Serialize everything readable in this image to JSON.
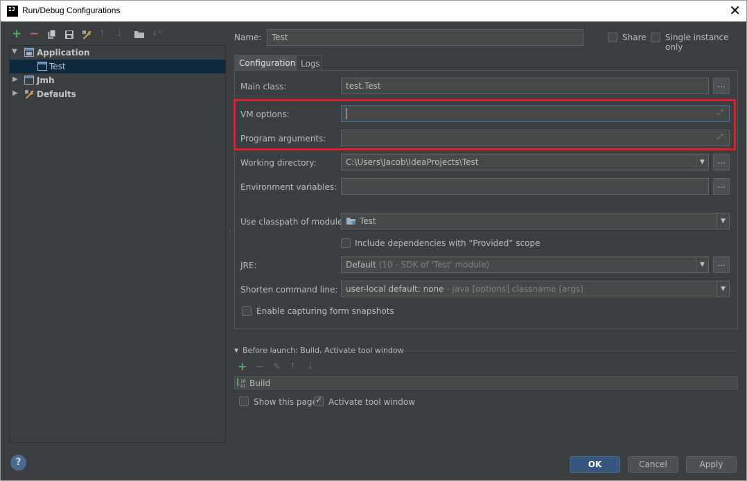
{
  "window": {
    "title": "Run/Debug Configurations",
    "app_icon": "IJ"
  },
  "toolbar": {
    "icons": [
      "add-icon",
      "remove-icon",
      "copy-icon",
      "save-icon",
      "wrench-icon",
      "arrow-up-icon",
      "arrow-down-icon",
      "folder-icon",
      "sort-icon"
    ]
  },
  "tree": {
    "items": [
      {
        "label": "Application"
      },
      {
        "label": "Test"
      },
      {
        "label": "Jmh"
      },
      {
        "label": "Defaults"
      }
    ]
  },
  "header": {
    "name_label": "Name:",
    "name_value": "Test",
    "share_label": "Share",
    "single_instance_label": "Single instance only"
  },
  "tabs": [
    {
      "label": "Configuration"
    },
    {
      "label": "Logs"
    }
  ],
  "form": {
    "main_class_label": "Main class:",
    "main_class_value": "test.Test",
    "vm_options_label": "VM options:",
    "vm_options_value": "",
    "program_arguments_label": "Program arguments:",
    "program_arguments_value": "",
    "working_directory_label": "Working directory:",
    "working_directory_value": "C:\\Users\\Jacob\\IdeaProjects\\Test",
    "env_vars_label": "Environment variables:",
    "env_vars_value": "",
    "classpath_label": "Use classpath of module:",
    "classpath_value": "Test",
    "include_deps_label": "Include dependencies with “Provided” scope",
    "jre_label": "JRE:",
    "jre_value_main": "Default",
    "jre_value_detail": "(10 - SDK of 'Test' module)",
    "shorten_label": "Shorten command line:",
    "shorten_value_main": "user-local default: none",
    "shorten_value_detail": "- java [options] classname [args]",
    "snapshots_label": "Enable capturing form snapshots",
    "dots_label": "..."
  },
  "before_launch": {
    "title": "Before launch: Build, Activate tool window",
    "build_label": "Build",
    "show_page_label": "Show this page",
    "activate_label": "Activate tool window",
    "activate_checked": true
  },
  "buttons": {
    "ok": "OK",
    "cancel": "Cancel",
    "apply": "Apply",
    "help": "?"
  },
  "colors": {
    "highlight": "#e41e2f",
    "primary_button": "#365880",
    "selection": "#0d293e"
  }
}
